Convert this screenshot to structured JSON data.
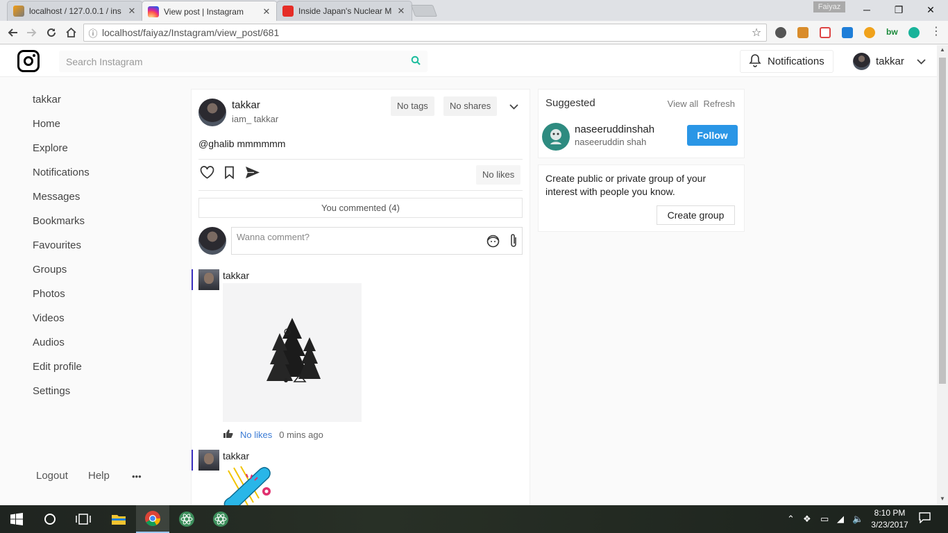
{
  "browser": {
    "tabs": [
      {
        "title": "localhost / 127.0.0.1 / ins",
        "active": false
      },
      {
        "title": "View post | Instagram",
        "active": true
      },
      {
        "title": "Inside Japan's Nuclear M",
        "active": false
      }
    ],
    "profile_name": "Faiyaz",
    "url": "localhost/faiyaz/Instagram/view_post/681"
  },
  "header": {
    "search_placeholder": "Search Instagram",
    "notifications_label": "Notifications",
    "username": "takkar"
  },
  "sidebar": {
    "items": [
      "takkar",
      "Home",
      "Explore",
      "Notifications",
      "Messages",
      "Bookmarks",
      "Favourites",
      "Groups",
      "Photos",
      "Videos",
      "Audios",
      "Edit profile",
      "Settings"
    ],
    "footer": {
      "logout": "Logout",
      "help": "Help",
      "more": "•••"
    }
  },
  "post": {
    "username": "takkar",
    "handle": "iam_ takkar",
    "tags_label": "No tags",
    "shares_label": "No shares",
    "text": "@ghalib mmmmmm",
    "likes_label": "No likes",
    "commented_label": "You commented (4)",
    "comment_placeholder": "Wanna comment?"
  },
  "comments": [
    {
      "username": "takkar",
      "likes_label": "No likes",
      "time": "0 mins ago"
    },
    {
      "username": "takkar"
    }
  ],
  "suggested": {
    "title": "Suggested",
    "view_all": "View all",
    "refresh": "Refresh",
    "user": {
      "name": "naseeruddinshah",
      "handle": "naseeruddin shah"
    },
    "follow_label": "Follow"
  },
  "group_card": {
    "text": "Create public or private group of your interest with people you know.",
    "button_label": "Create group"
  },
  "taskbar": {
    "time": "8:10 PM",
    "date": "3/23/2017"
  },
  "colors": {
    "accent": "#2a96e6",
    "comment_bar": "#3a2fbf",
    "link": "#3a7bd5"
  }
}
